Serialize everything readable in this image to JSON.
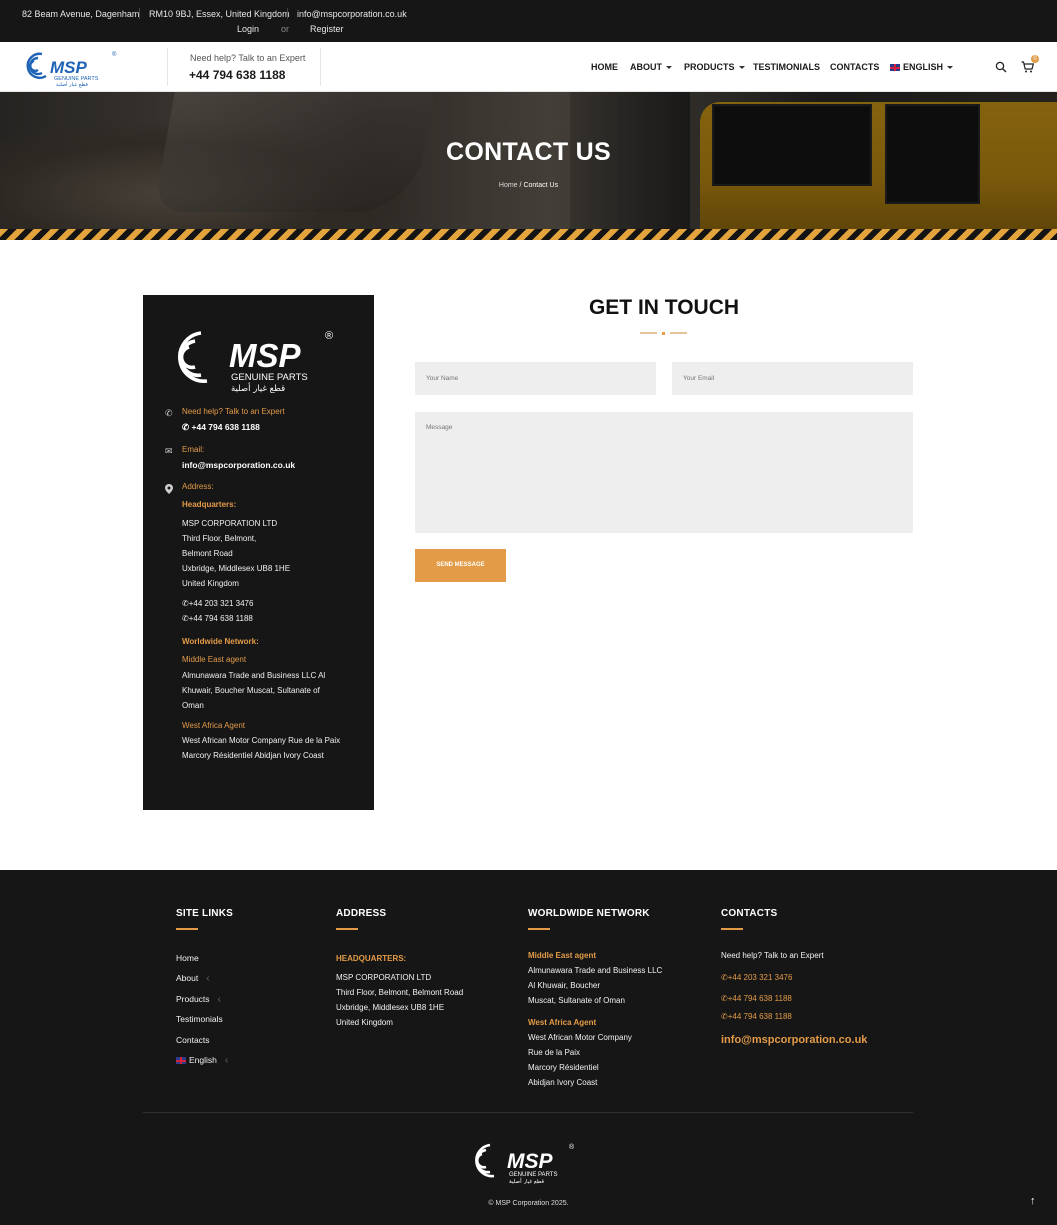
{
  "topbar": {
    "address1": "82 Beam Avenue, Dagenham",
    "address2": "RM10 9BJ, Essex, United Kingdom",
    "email": "info@mspcorporation.co.uk",
    "login": "Login",
    "or": "or",
    "register": "Register"
  },
  "header": {
    "logo_text": "MSP",
    "logo_sub": "GENUINE PARTS",
    "logo_arabic": "قطع غيار أصلية",
    "logo_reg": "®",
    "help_label": "Need help? Talk to an Expert",
    "help_phone": "+44 794 638 1188",
    "cart_count": "0"
  },
  "nav": {
    "home": "HOME",
    "about": "ABOUT",
    "products": "PRODUCTS",
    "testimonials": "TESTIMONIALS",
    "contacts": "CONTACTS",
    "language": "ENGLISH"
  },
  "hero": {
    "title": "CONTACT US",
    "crumb_home": "Home",
    "crumb_sep": "/",
    "crumb_current": "Contact Us"
  },
  "card": {
    "help_label": "Need help? Talk to an Expert",
    "help_phone": "+44 794 638 1188",
    "email_label": "Email:",
    "email": "info@mspcorporation.co.uk",
    "address_label": "Address:",
    "hq_label": "Headquarters:",
    "hq_lines": [
      "MSP CORPORATION LTD",
      "Third Floor, Belmont,",
      "Belmont Road",
      "Uxbridge, Middlesex UB8 1HE",
      "United Kingdom"
    ],
    "phone1": "+44 203 321  3476",
    "phone2": "+44 794 638 1188",
    "network_label": "Worldwide Network:",
    "me_label": "Middle East agent",
    "me_lines": [
      "Almunawara Trade and Business LLC Al",
      "Khuwair, Boucher Muscat, Sultanate of",
      "Oman"
    ],
    "wa_label": "West Africa Agent",
    "wa_lines": [
      "West African Motor Company Rue de la Paix",
      "Marcory Résidentiel Abidjan Ivory Coast"
    ]
  },
  "form": {
    "title": "GET IN TOUCH",
    "name_placeholder": "Your Name",
    "email_placeholder": "Your Email",
    "message_placeholder": "Message",
    "send": "SEND MESSAGE"
  },
  "footer": {
    "site_links_title": "SITE LINKS",
    "links": [
      "Home",
      "About",
      "Products",
      "Testimonials",
      "Contacts",
      "English"
    ],
    "address_title": "ADDRESS",
    "hq_label": "HEADQUARTERS:",
    "hq_lines": [
      "MSP CORPORATION LTD",
      "Third Floor, Belmont, Belmont Road",
      "Uxbridge, Middlesex UB8 1HE",
      "United Kingdom"
    ],
    "network_title": "WORLDWIDE NETWORK",
    "me_label": "Middle East agent",
    "me_lines": [
      "Almunawara Trade and Business LLC",
      "Al Khuwair, Boucher",
      "Muscat, Sultanate of Oman"
    ],
    "wa_label": "West Africa Agent",
    "wa_lines": [
      "West African Motor Company",
      "Rue de la Paix",
      "Marcory Résidentiel",
      "Abidjan Ivory Coast"
    ],
    "contacts_title": "CONTACTS",
    "contacts_help": "Need help? Talk to an Expert",
    "phone1": "+44 203 321 3476",
    "phone2": "+44 794 638 1188",
    "phone3": "+44 794 638 1188",
    "email": "info@mspcorporation.co.uk",
    "copyright": "© MSP Corporation 2025."
  },
  "colors": {
    "accent": "#e39b48",
    "dark": "#161616",
    "brand_blue": "#1e63b5"
  }
}
